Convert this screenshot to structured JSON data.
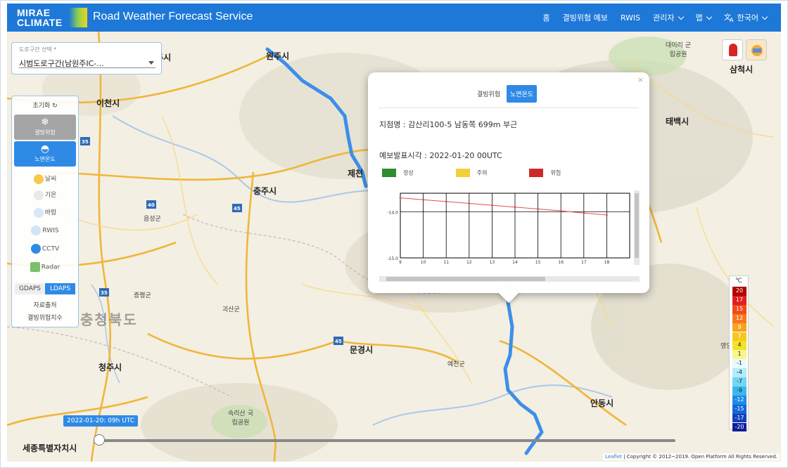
{
  "header": {
    "logo_line1": "MIRAE",
    "logo_line2": "CLIMATE",
    "title": "Road Weather Forecast Service",
    "nav": [
      {
        "label": "홈",
        "dropdown": false
      },
      {
        "label": "결빙위험 예보",
        "dropdown": false
      },
      {
        "label": "RWIS",
        "dropdown": false
      },
      {
        "label": "관리자",
        "dropdown": true
      },
      {
        "label": "맵",
        "dropdown": true
      },
      {
        "label": "한국어",
        "dropdown": true
      }
    ]
  },
  "route_select": {
    "label": "도로구간 선택 *",
    "value": "시범도로구간(남원주IC-..."
  },
  "side_panel": {
    "init_label": "초기화",
    "freeze_label": "결빙위험",
    "road_temp_label": "노면온도",
    "layers": [
      "날씨",
      "기온",
      "바람",
      "RWIS",
      "CCTV",
      "Radar"
    ],
    "gdaps_label": "GDAPS",
    "ldaps_label": "LDAPS",
    "data_output_label": "자료출처",
    "freeze_index_label": "결빙위험지수"
  },
  "map": {
    "places": [
      "원주시",
      "여주시",
      "이천시",
      "충주시",
      "제천",
      "태백시",
      "삼척시",
      "문경시",
      "청주시",
      "안동시",
      "세종특별자치시",
      "충청북도",
      "음성군",
      "괴산군",
      "증평군",
      "예천군",
      "속리산 국립공원",
      "대이리 군립공원",
      "영양"
    ]
  },
  "popup": {
    "tab_freeze": "결빙위험",
    "tab_road_temp": "노면온도",
    "location_label": "지점명",
    "location_value": "감산리100-5 남동쪽 699m 부근",
    "forecast_label": "예보발표시각",
    "forecast_value": "2022-01-20 00UTC",
    "legend": [
      {
        "label": "정상",
        "color": "#2e8b2e"
      },
      {
        "label": "주의",
        "color": "#f3d03a"
      },
      {
        "label": "위험",
        "color": "#cc2a2a"
      }
    ],
    "close_label": "×"
  },
  "chart_data": {
    "type": "line",
    "x": [
      9,
      10,
      11,
      12,
      13,
      14,
      15,
      16,
      17,
      18
    ],
    "series": [
      {
        "values": [
          -13.7,
          -13.74,
          -13.78,
          -13.82,
          -13.86,
          -13.9,
          -13.94,
          -13.98,
          -14.03,
          -14.07
        ]
      }
    ],
    "yticks": [
      -14.0,
      -15.0
    ],
    "ylim": [
      -15.0,
      -13.6
    ],
    "xlim": [
      9,
      19
    ],
    "line_color": "#d9534f",
    "grid": true
  },
  "colorbar": {
    "unit": "℃",
    "values": [
      "20",
      "17",
      "15",
      "12",
      "9",
      "7",
      "4",
      "1",
      "-1",
      "-4",
      "-7",
      "-9",
      "-12",
      "-15",
      "-17",
      "-20"
    ],
    "colors": [
      "#b30000",
      "#e02020",
      "#f24a1a",
      "#f7781c",
      "#f7a31c",
      "#f7c71c",
      "#f3e22a",
      "#f8f58c",
      "#e7fbff",
      "#b4ecf9",
      "#72d6f4",
      "#3cb8f0",
      "#1a8ce6",
      "#1565d6",
      "#1240b8",
      "#0d1f96"
    ]
  },
  "time": {
    "current": "2022-01-20: 09h UTC"
  },
  "attribution": {
    "leaflet": "Leaflet",
    "rest": "| Copyright © 2012~2019. Open Platform All Rights Reserved."
  }
}
